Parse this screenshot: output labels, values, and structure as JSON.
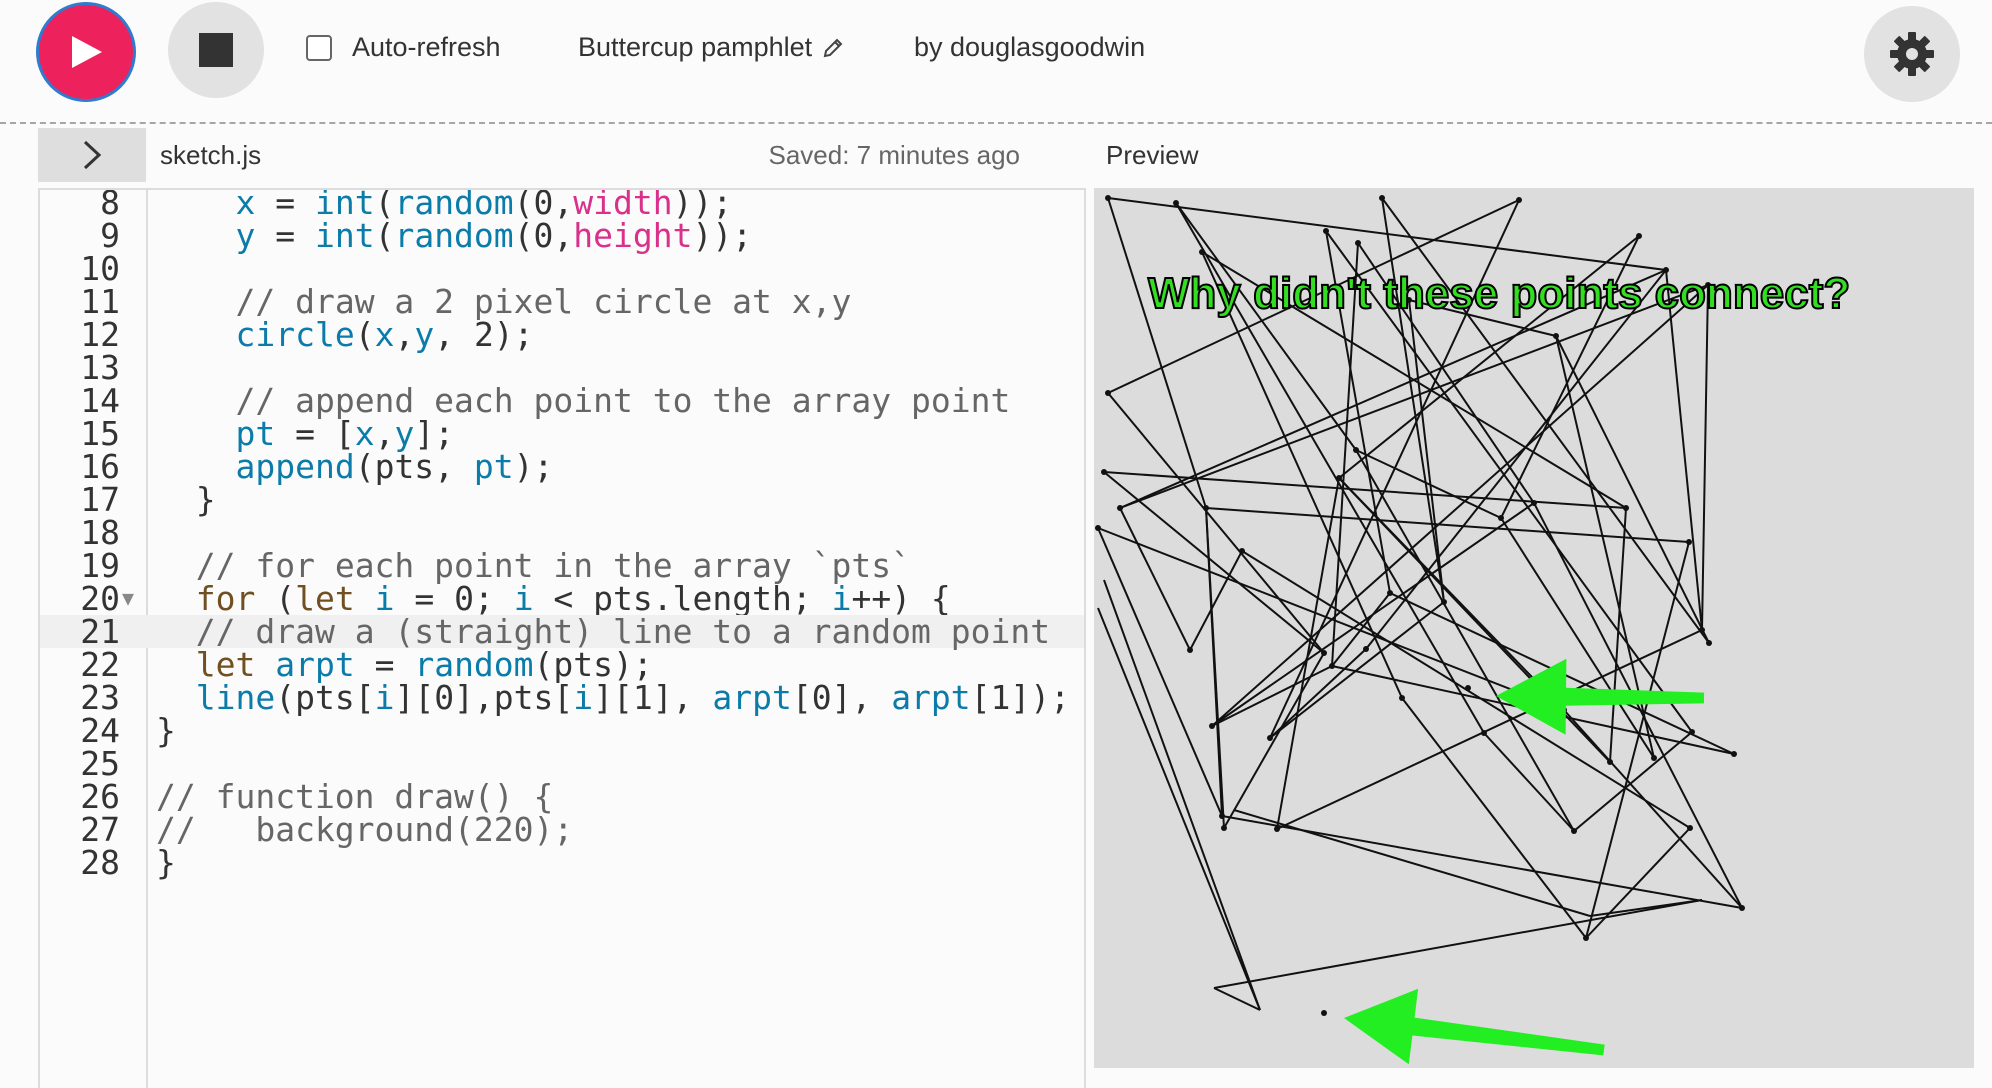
{
  "toolbar": {
    "play_icon": "play-icon",
    "stop_icon": "stop-icon",
    "auto_refresh_label": "Auto-refresh",
    "project_name": "Buttercup pamphlet",
    "author": "by douglasgoodwin",
    "settings_icon": "gear-icon",
    "accent_color": "#ed225d"
  },
  "editor": {
    "file_name": "sketch.js",
    "saved_status": "Saved: 7 minutes ago",
    "active_line": 21,
    "lines": [
      {
        "n": "8"
      },
      {
        "n": "9"
      },
      {
        "n": "10"
      },
      {
        "n": "11"
      },
      {
        "n": "12"
      },
      {
        "n": "13"
      },
      {
        "n": "14"
      },
      {
        "n": "15"
      },
      {
        "n": "16"
      },
      {
        "n": "17"
      },
      {
        "n": "18"
      },
      {
        "n": "19"
      },
      {
        "n": "20"
      },
      {
        "n": "21"
      },
      {
        "n": "22"
      },
      {
        "n": "23"
      },
      {
        "n": "24"
      },
      {
        "n": "25"
      },
      {
        "n": "26"
      },
      {
        "n": "27"
      },
      {
        "n": "28"
      }
    ],
    "code": [
      "    x = int(random(0,width));",
      "    y = int(random(0,height));",
      "",
      "    // draw a 2 pixel circle at x,y",
      "    circle(x,y, 2);",
      "",
      "    // append each point to the array point",
      "    pt = [x,y];",
      "    append(pts, pt);",
      "  }",
      "",
      "  // for each point in the array `pts`",
      "  for (let i = 0; i < pts.length; i++) {",
      "  // draw a (straight) line to a random point",
      "  let arpt = random(pts);",
      "  line(pts[i][0],pts[i][1], arpt[0], arpt[1]);",
      "}",
      "",
      "// function draw() {",
      "//   background(220);",
      "}"
    ]
  },
  "preview": {
    "label": "Preview",
    "annotation": "Why didn't these points connect?",
    "annotation_color": "#33dd22",
    "arrow_color": "#22ee22"
  }
}
